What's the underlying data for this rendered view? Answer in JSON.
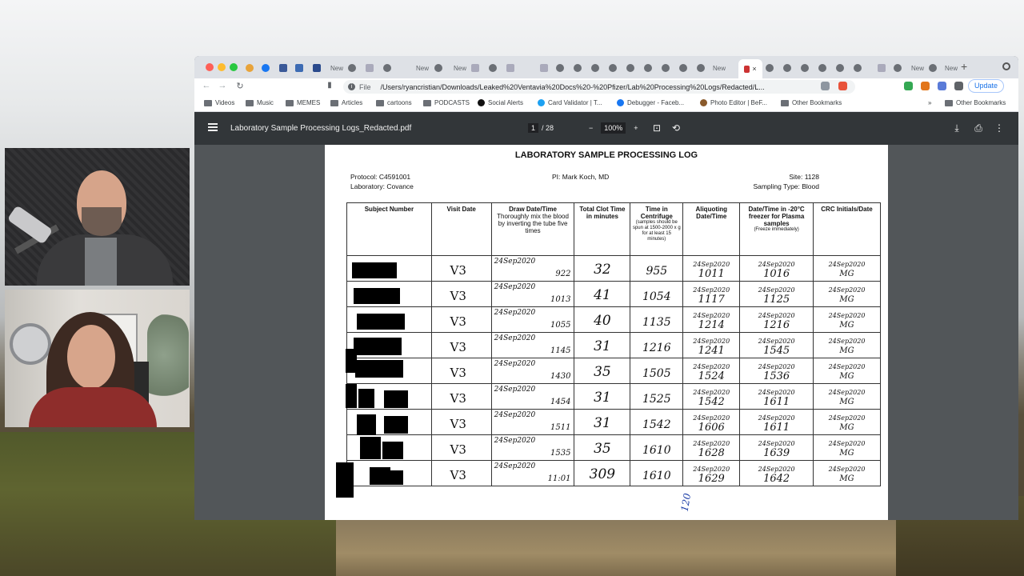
{
  "browser": {
    "tabs": [
      "New",
      "New",
      "New",
      "New",
      "New",
      "New",
      "New",
      "New"
    ],
    "active_tab_close": "×",
    "newtab": "+",
    "omnibox": {
      "scheme": "File",
      "url": "/Users/ryancristian/Downloads/Leaked%20Ventavia%20Docs%20-%20Pfizer/Lab%20Processing%20Logs/Redacted/L..."
    },
    "update_label": "Update",
    "bookmarks": [
      "Videos",
      "Music",
      "MEMES",
      "Articles",
      "cartoons",
      "PODCASTS",
      "Social Alerts",
      "Card Validator | T...",
      "Debugger - Faceb...",
      "Photo Editor | BeF...",
      "Other Bookmarks"
    ],
    "other_bookmarks": "Other Bookmarks",
    "overflow": "»"
  },
  "pdf": {
    "filename": "Laboratory Sample Processing Logs_Redacted.pdf",
    "page_current": "1",
    "page_total": "/ 28",
    "zoom": "100%",
    "minus": "−",
    "plus": "+"
  },
  "document": {
    "title": "LABORATORY SAMPLE PROCESSING LOG",
    "protocol": "Protocol: C4591001",
    "laboratory": "Laboratory: Covance",
    "pi": "PI: Mark Koch, MD",
    "site": "Site: 1128",
    "sampling_type": "Sampling Type: Blood",
    "columns": [
      {
        "label": "Subject Number",
        "note": ""
      },
      {
        "label": "Visit Date",
        "note": ""
      },
      {
        "label": "Draw Date/Time",
        "note": "Thoroughly mix the blood by inverting the tube five times"
      },
      {
        "label": "Total Clot Time in minutes",
        "note": ""
      },
      {
        "label": "Time in Centrifuge",
        "note": "(samples should be spun at 1500-2000 x g for at least 15 minutes)"
      },
      {
        "label": "Aliquoting Date/Time",
        "note": ""
      },
      {
        "label": "Date/Time in -20°C freezer for Plasma samples",
        "note": "(Freeze immediately)"
      },
      {
        "label": "CRC Initials/Date",
        "note": ""
      }
    ],
    "rows": [
      {
        "visit": "V3",
        "draw_date": "24Sep2020",
        "draw_time": "922",
        "clot": "32",
        "centrifuge": "955",
        "aliq_date": "24Sep2020",
        "aliq_time": "1011",
        "freeze_date": "24Sep2020",
        "freeze_time": "1016",
        "crc_date": "24Sep2020",
        "crc_init": "MG"
      },
      {
        "visit": "V3",
        "draw_date": "24Sep2020",
        "draw_time": "1013",
        "clot": "41",
        "centrifuge": "1054",
        "aliq_date": "24Sep2020",
        "aliq_time": "1117",
        "freeze_date": "24Sep2020",
        "freeze_time": "1125",
        "crc_date": "24Sep2020",
        "crc_init": "MG"
      },
      {
        "visit": "V3",
        "draw_date": "24Sep2020",
        "draw_time": "1055",
        "clot": "40",
        "centrifuge": "1135",
        "aliq_date": "24Sep2020",
        "aliq_time": "1214",
        "freeze_date": "24Sep2020",
        "freeze_time": "1216",
        "crc_date": "24Sep2020",
        "crc_init": "MG"
      },
      {
        "visit": "V3",
        "draw_date": "24Sep2020",
        "draw_time": "1145",
        "clot": "31",
        "centrifuge": "1216",
        "aliq_date": "24Sep2020",
        "aliq_time": "1241",
        "freeze_date": "24Sep2020",
        "freeze_time": "1545",
        "crc_date": "24Sep2020",
        "crc_init": "MG"
      },
      {
        "visit": "V3",
        "draw_date": "24Sep2020",
        "draw_time": "1430",
        "clot": "35",
        "centrifuge": "1505",
        "aliq_date": "24Sep2020",
        "aliq_time": "1524",
        "freeze_date": "24Sep2020",
        "freeze_time": "1536",
        "crc_date": "24Sep2020",
        "crc_init": "MG"
      },
      {
        "visit": "V3",
        "draw_date": "24Sep2020",
        "draw_time": "1454",
        "clot": "31",
        "centrifuge": "1525",
        "aliq_date": "24Sep2020",
        "aliq_time": "1542",
        "freeze_date": "24Sep2020",
        "freeze_time": "1611",
        "crc_date": "24Sep2020",
        "crc_init": "MG"
      },
      {
        "visit": "V3",
        "draw_date": "24Sep2020",
        "draw_time": "1511",
        "clot": "31",
        "centrifuge": "1542",
        "aliq_date": "24Sep2020",
        "aliq_time": "1606",
        "freeze_date": "24Sep2020",
        "freeze_time": "1611",
        "crc_date": "24Sep2020",
        "crc_init": "MG"
      },
      {
        "visit": "V3",
        "draw_date": "24Sep2020",
        "draw_time": "1535",
        "clot": "35",
        "centrifuge": "1610",
        "aliq_date": "24Sep2020",
        "aliq_time": "1628",
        "freeze_date": "24Sep2020",
        "freeze_time": "1639",
        "crc_date": "24Sep2020",
        "crc_init": "MG"
      },
      {
        "visit": "V3",
        "draw_date": "24Sep2020",
        "draw_time": "11:01",
        "clot": "309",
        "centrifuge": "1610",
        "aliq_date": "24Sep2020",
        "aliq_time": "1629",
        "freeze_date": "24Sep2020",
        "freeze_time": "1642",
        "crc_date": "24Sep2020",
        "crc_init": "MG"
      }
    ],
    "footer_note": "120"
  },
  "colors": {
    "pdf_bg": "#525659",
    "pdf_toolbar": "#323639",
    "accent": "#1a73e8"
  }
}
